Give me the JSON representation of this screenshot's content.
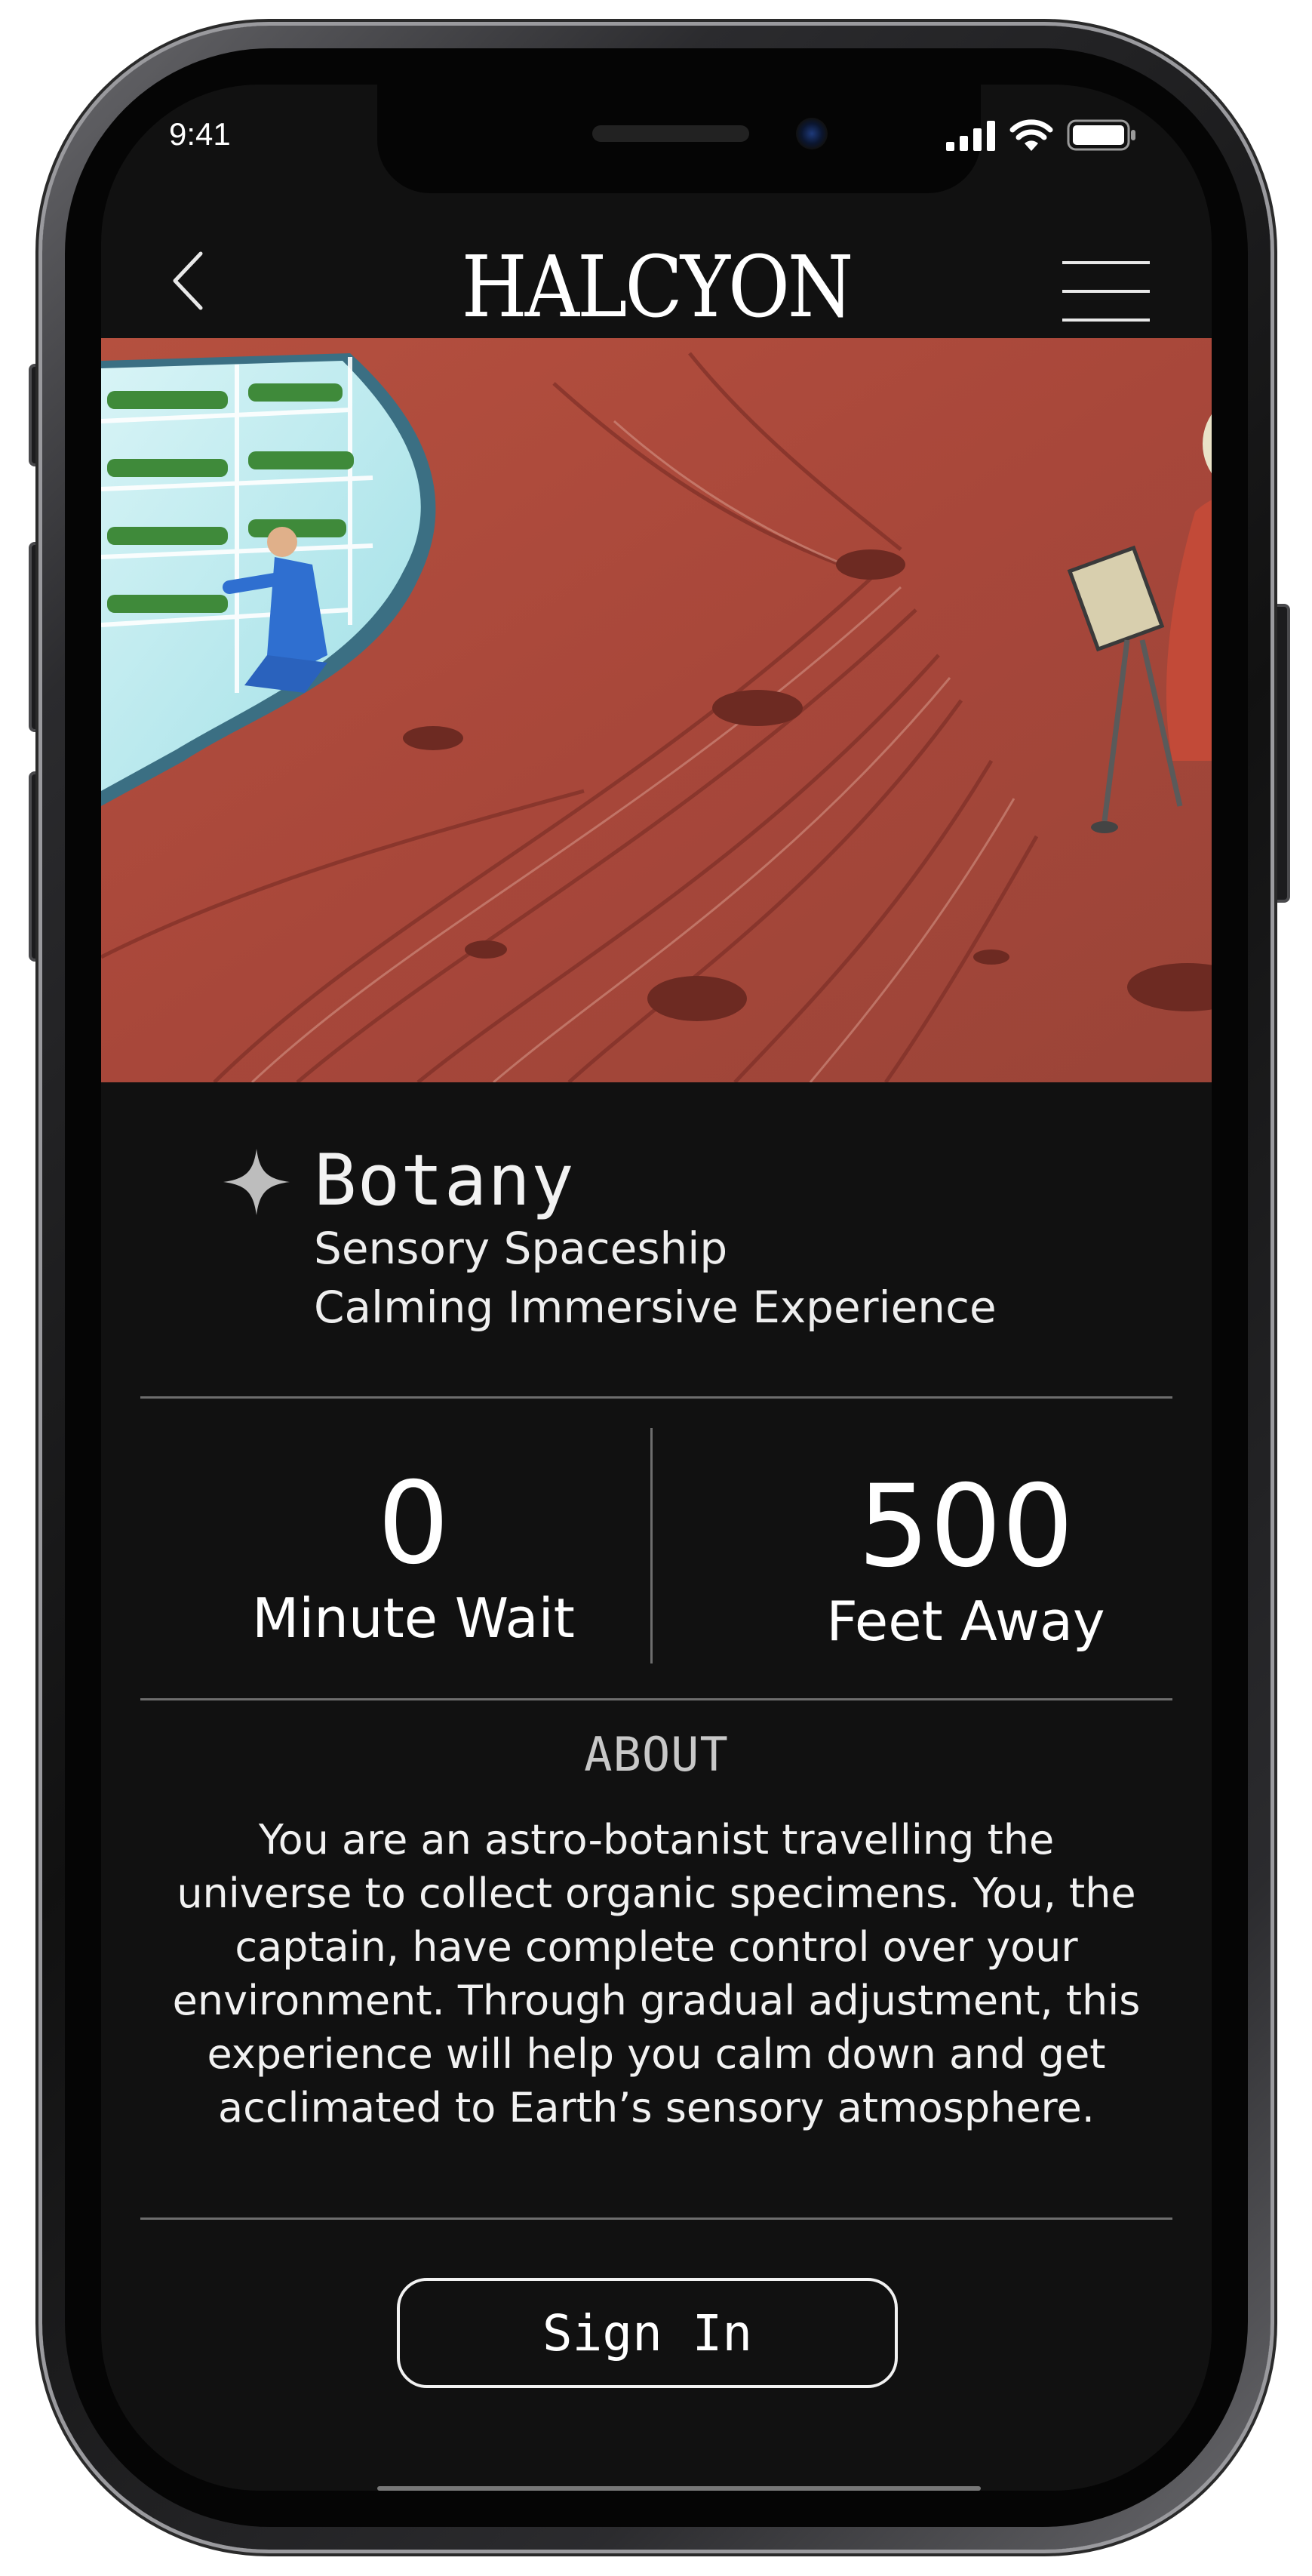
{
  "status_bar": {
    "time": "9:41"
  },
  "header": {
    "logo": "HALCYON",
    "back_icon": "chevron-left-icon",
    "menu_icon": "hamburger-menu-icon"
  },
  "hero": {
    "image": "illustration of an astronaut botanist in a red martian cave beside a greenhouse window"
  },
  "experience": {
    "icon": "sparkle-icon",
    "title": "Botany",
    "subtitle_1": "Sensory Spaceship",
    "subtitle_2": "Calming Immersive Experience"
  },
  "stats": {
    "wait_value": "0",
    "wait_label": "Minute Wait",
    "distance_value": "500",
    "distance_label": "Feet Away"
  },
  "about": {
    "heading": "ABOUT",
    "body": "You are an astro-botanist travelling the universe to collect organic specimens. You, the captain, have complete control over your environment. Through gradual adjustment, this experience will help you calm down and get acclimated to Earth’s sensory atmosphere."
  },
  "actions": {
    "sign_in": "Sign In"
  },
  "colors": {
    "background": "#111111",
    "text": "#f2f2f2",
    "divider": "#6d6d6d",
    "hero_rock": "#a8473a"
  }
}
